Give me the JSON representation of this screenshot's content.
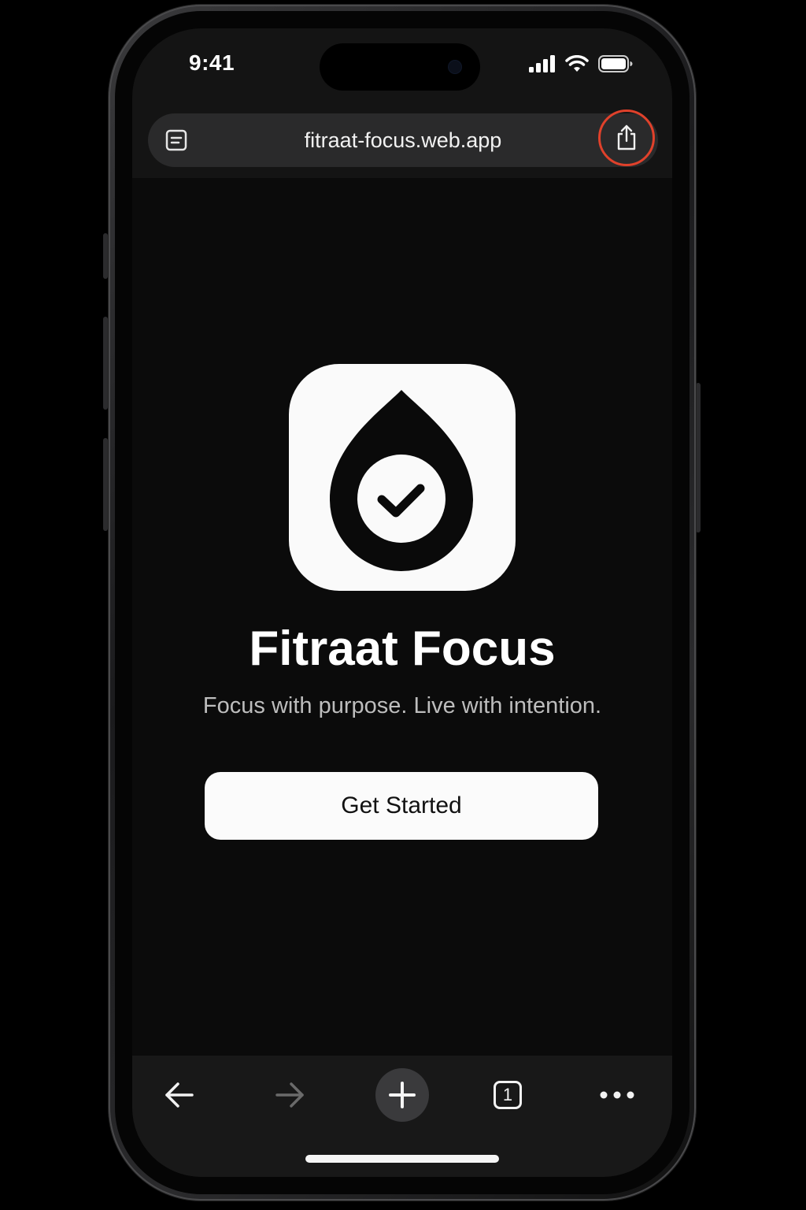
{
  "status_bar": {
    "time": "9:41",
    "icons": [
      "cellular-signal-icon",
      "wifi-icon",
      "battery-icon"
    ]
  },
  "browser": {
    "url": "fitraat-focus.web.app",
    "reader_icon": "reader-mode-icon",
    "share_icon": "share-icon",
    "share_highlight_color": "#e0412b"
  },
  "app": {
    "icon": "drop-checkmark-logo",
    "title": "Fitraat Focus",
    "subtitle": "Focus with purpose. Live with intention.",
    "cta_label": "Get Started"
  },
  "toolbar": {
    "items": [
      {
        "name": "back-button",
        "icon": "arrow-left-icon"
      },
      {
        "name": "forward-button",
        "icon": "arrow-right-icon",
        "disabled": true
      },
      {
        "name": "new-tab-button",
        "icon": "plus-icon"
      },
      {
        "name": "tabs-button",
        "icon": "tabs-icon",
        "count": "1"
      },
      {
        "name": "more-button",
        "icon": "ellipsis-icon"
      }
    ]
  }
}
